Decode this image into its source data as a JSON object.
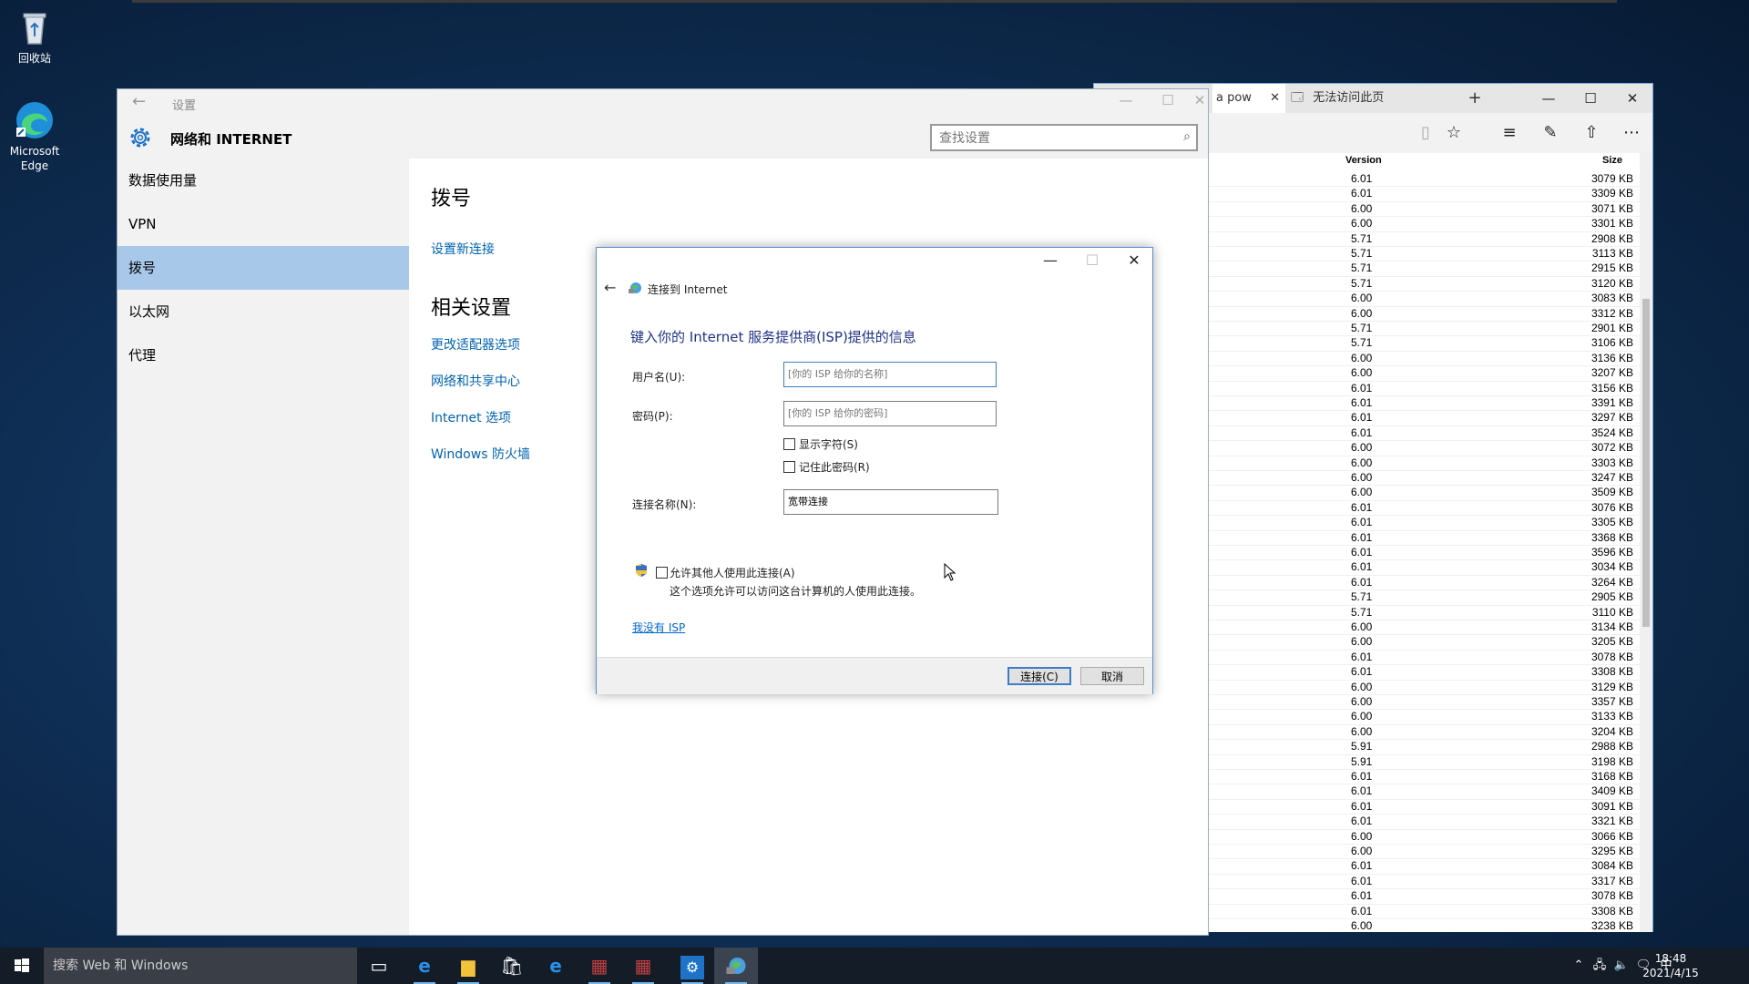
{
  "desktop": {
    "icons": [
      {
        "label": "回收站"
      },
      {
        "label": "Microsoft Edge"
      }
    ]
  },
  "browser": {
    "tab_partial": "a pow",
    "tab_title": "无法访问此页",
    "new_tab": "+",
    "columns": {
      "version": "Version",
      "size": "Size"
    },
    "rows": [
      [
        "6.01",
        "3079 KB"
      ],
      [
        "6.01",
        "3309 KB"
      ],
      [
        "6.00",
        "3071 KB"
      ],
      [
        "6.00",
        "3301 KB"
      ],
      [
        "5.71",
        "2908 KB"
      ],
      [
        "5.71",
        "3113 KB"
      ],
      [
        "5.71",
        "2915 KB"
      ],
      [
        "5.71",
        "3120 KB"
      ],
      [
        "6.00",
        "3083 KB"
      ],
      [
        "6.00",
        "3312 KB"
      ],
      [
        "5.71",
        "2901 KB"
      ],
      [
        "5.71",
        "3106 KB"
      ],
      [
        "6.00",
        "3136 KB"
      ],
      [
        "6.00",
        "3207 KB"
      ],
      [
        "6.01",
        "3156 KB"
      ],
      [
        "6.01",
        "3391 KB"
      ],
      [
        "6.01",
        "3297 KB"
      ],
      [
        "6.01",
        "3524 KB"
      ],
      [
        "6.00",
        "3072 KB"
      ],
      [
        "6.00",
        "3303 KB"
      ],
      [
        "6.00",
        "3247 KB"
      ],
      [
        "6.00",
        "3509 KB"
      ],
      [
        "6.01",
        "3076 KB"
      ],
      [
        "6.01",
        "3305 KB"
      ],
      [
        "6.01",
        "3368 KB"
      ],
      [
        "6.01",
        "3596 KB"
      ],
      [
        "6.01",
        "3034 KB"
      ],
      [
        "6.01",
        "3264 KB"
      ],
      [
        "5.71",
        "2905 KB"
      ],
      [
        "5.71",
        "3110 KB"
      ],
      [
        "6.00",
        "3134 KB"
      ],
      [
        "6.00",
        "3205 KB"
      ],
      [
        "6.01",
        "3078 KB"
      ],
      [
        "6.01",
        "3308 KB"
      ],
      [
        "6.00",
        "3129 KB"
      ],
      [
        "6.00",
        "3357 KB"
      ],
      [
        "6.00",
        "3133 KB"
      ],
      [
        "6.00",
        "3204 KB"
      ],
      [
        "5.91",
        "2988 KB"
      ],
      [
        "5.91",
        "3198 KB"
      ],
      [
        "6.01",
        "3168 KB"
      ],
      [
        "6.01",
        "3409 KB"
      ],
      [
        "6.01",
        "3091 KB"
      ],
      [
        "6.01",
        "3321 KB"
      ],
      [
        "6.00",
        "3066 KB"
      ],
      [
        "6.00",
        "3295 KB"
      ],
      [
        "6.01",
        "3084 KB"
      ],
      [
        "6.01",
        "3317 KB"
      ],
      [
        "6.01",
        "3078 KB"
      ],
      [
        "6.01",
        "3308 KB"
      ],
      [
        "6.00",
        "3238 KB"
      ]
    ]
  },
  "settings": {
    "window_title": "设置",
    "header_title": "网络和 INTERNET",
    "search_placeholder": "查找设置",
    "nav": [
      {
        "label": "数据使用量"
      },
      {
        "label": "VPN"
      },
      {
        "label": "拨号",
        "active": true
      },
      {
        "label": "以太网"
      },
      {
        "label": "代理"
      }
    ],
    "main_title": "拨号",
    "setup_link": "设置新连接",
    "related_title": "相关设置",
    "related_links": [
      "更改适配器选项",
      "网络和共享中心",
      "Internet 选项",
      "Windows 防火墙"
    ]
  },
  "dialog": {
    "title": "连接到 Internet",
    "heading": "键入你的 Internet 服务提供商(ISP)提供的信息",
    "username_label": "用户名(U):",
    "username_placeholder": "[你的 ISP 给你的名称]",
    "password_label": "密码(P):",
    "password_placeholder": "[你的 ISP 给你的密码]",
    "show_chars": "显示字符(S)",
    "remember_pw": "记住此密码(R)",
    "conn_name_label": "连接名称(N):",
    "conn_name_value": "宽带连接",
    "allow_others": "允许其他人使用此连接(A)",
    "allow_desc": "这个选项允许可以访问这台计算机的人使用此连接。",
    "no_isp": "我没有 ISP",
    "connect_btn": "连接(C)",
    "cancel_btn": "取消"
  },
  "taskbar": {
    "search_placeholder": "搜索 Web 和 Windows",
    "ime": "中",
    "time": "18:48",
    "date": "2021/4/15"
  },
  "colors": {
    "accent": "#0063b1",
    "nav_active": "#a8c8ea",
    "dialog_heading": "#1e3287",
    "taskbar": "#141c28"
  }
}
